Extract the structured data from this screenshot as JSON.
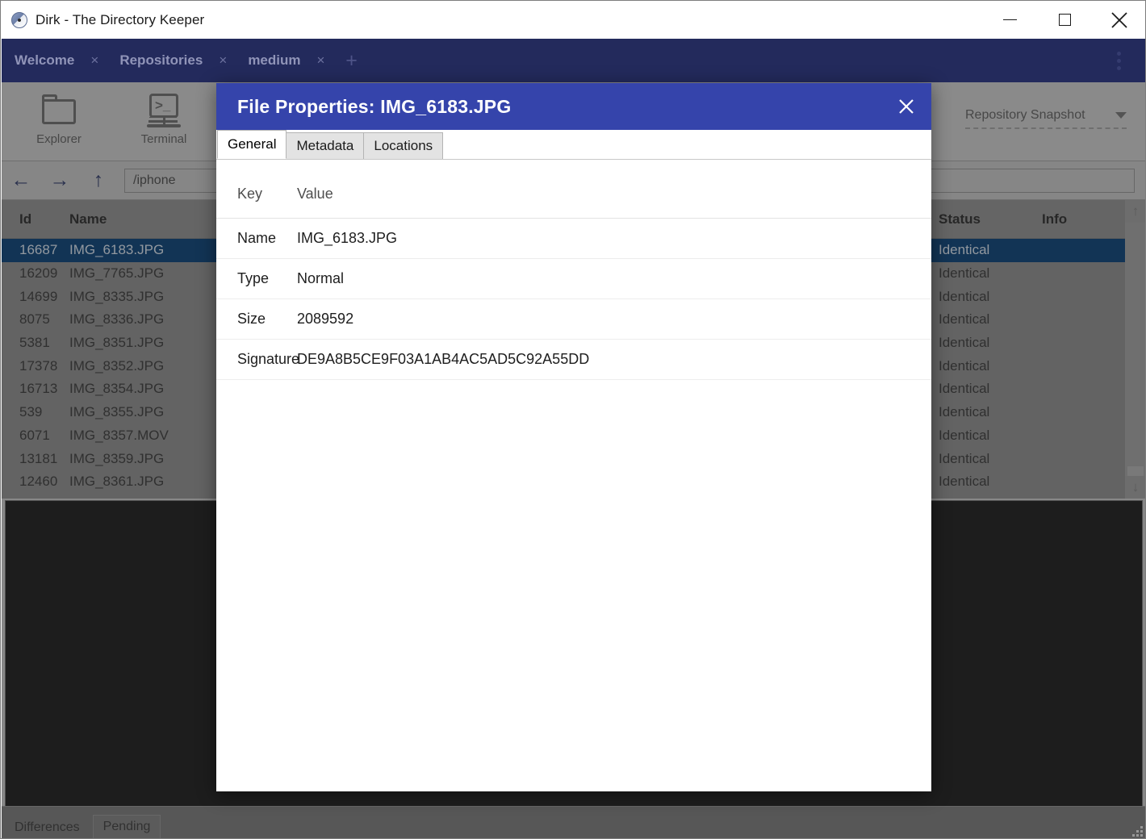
{
  "window": {
    "title": "Dirk - The Directory Keeper",
    "icon": "disc-icon",
    "controls": {
      "minimize": "minimize-icon",
      "maximize": "maximize-icon",
      "close": "close-icon"
    }
  },
  "tabs": {
    "items": [
      {
        "label": "Welcome",
        "close": "×"
      },
      {
        "label": "Repositories",
        "close": "×"
      },
      {
        "label": "medium",
        "close": "×"
      }
    ],
    "add_label": "+",
    "overflow_menu": "kebab-menu-icon"
  },
  "ribbon": {
    "items": [
      {
        "label": "Explorer",
        "icon": "folder-icon"
      },
      {
        "label": "Terminal",
        "icon": "terminal-icon"
      }
    ],
    "snapshot": {
      "label": "Repository Snapshot",
      "caret": "chevron-down-icon"
    }
  },
  "nav": {
    "back": "←",
    "forward": "→",
    "up": "↑",
    "path_value": "/iphone",
    "path_placeholder": "/iphone"
  },
  "file_table": {
    "columns": [
      "Id",
      "Name",
      "Status",
      "Info"
    ],
    "rows": [
      {
        "id": "16687",
        "name": "IMG_6183.JPG",
        "status": "Identical",
        "info": "",
        "selected": true
      },
      {
        "id": "16209",
        "name": "IMG_7765.JPG",
        "status": "Identical",
        "info": "",
        "selected": false
      },
      {
        "id": "14699",
        "name": "IMG_8335.JPG",
        "status": "Identical",
        "info": "",
        "selected": false
      },
      {
        "id": "8075",
        "name": "IMG_8336.JPG",
        "status": "Identical",
        "info": "",
        "selected": false
      },
      {
        "id": "5381",
        "name": "IMG_8351.JPG",
        "status": "Identical",
        "info": "",
        "selected": false
      },
      {
        "id": "17378",
        "name": "IMG_8352.JPG",
        "status": "Identical",
        "info": "",
        "selected": false
      },
      {
        "id": "16713",
        "name": "IMG_8354.JPG",
        "status": "Identical",
        "info": "",
        "selected": false
      },
      {
        "id": "539",
        "name": "IMG_8355.JPG",
        "status": "Identical",
        "info": "",
        "selected": false
      },
      {
        "id": "6071",
        "name": "IMG_8357.MOV",
        "status": "Identical",
        "info": "",
        "selected": false
      },
      {
        "id": "13181",
        "name": "IMG_8359.JPG",
        "status": "Identical",
        "info": "",
        "selected": false
      },
      {
        "id": "12460",
        "name": "IMG_8361.JPG",
        "status": "Identical",
        "info": "",
        "selected": false
      }
    ],
    "scroll_up": "↑",
    "scroll_down": "↓"
  },
  "bottom_tabs": {
    "items": [
      "Differences",
      "Pending"
    ]
  },
  "dialog": {
    "title": "File Properties: IMG_6183.JPG",
    "close_icon": "close-icon",
    "tabs": [
      {
        "label": "General",
        "active": true
      },
      {
        "label": "Metadata",
        "active": false
      },
      {
        "label": "Locations",
        "active": false
      }
    ],
    "table": {
      "headers": {
        "key": "Key",
        "value": "Value"
      },
      "rows": [
        {
          "key": "Name",
          "value": "IMG_6183.JPG"
        },
        {
          "key": "Type",
          "value": "Normal"
        },
        {
          "key": "Size",
          "value": "2089592"
        },
        {
          "key": "Signature",
          "value": "DE9A8B5CE9F03A1AB4AC5AD5C92A55DD"
        }
      ]
    }
  },
  "colors": {
    "tabstrip_bg": "#232a5c",
    "dialog_header": "#3544ab",
    "selection": "#0d4072",
    "app_bg": "#bfbfbf",
    "dark_panel": "#1d1d1d"
  }
}
